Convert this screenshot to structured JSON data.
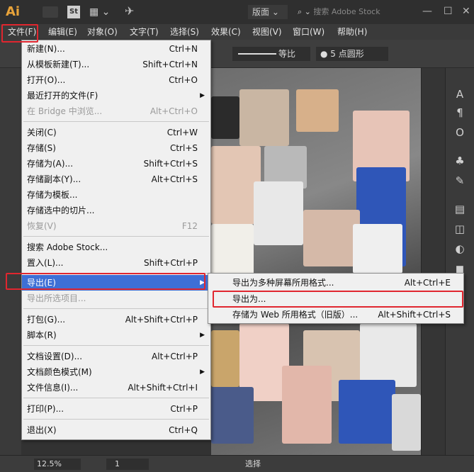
{
  "titlebar": {
    "logo": "Ai",
    "st_label": "St",
    "workspace": "版面 ⌄",
    "search_placeholder": "搜索 Adobe Stock"
  },
  "menubar": [
    {
      "id": "file",
      "label": "文件(F)"
    },
    {
      "id": "edit",
      "label": "编辑(E)"
    },
    {
      "id": "object",
      "label": "对象(O)"
    },
    {
      "id": "type",
      "label": "文字(T)"
    },
    {
      "id": "select",
      "label": "选择(S)"
    },
    {
      "id": "effect",
      "label": "效果(C)"
    },
    {
      "id": "view",
      "label": "视图(V)"
    },
    {
      "id": "window",
      "label": "窗口(W)"
    },
    {
      "id": "help",
      "label": "帮助(H)"
    }
  ],
  "controlbar": {
    "stroke_label": "等比",
    "brush_label": "●  5 点圆形"
  },
  "file_menu": [
    {
      "label": "新建(N)...",
      "shortcut": "Ctrl+N"
    },
    {
      "label": "从模板新建(T)...",
      "shortcut": "Shift+Ctrl+N"
    },
    {
      "label": "打开(O)...",
      "shortcut": "Ctrl+O"
    },
    {
      "label": "最近打开的文件(F)",
      "shortcut": "",
      "submenu": true
    },
    {
      "label": "在 Bridge 中浏览...",
      "shortcut": "Alt+Ctrl+O",
      "disabled": true
    },
    {
      "label": "关闭(C)",
      "shortcut": "Ctrl+W"
    },
    {
      "label": "存储(S)",
      "shortcut": "Ctrl+S"
    },
    {
      "label": "存储为(A)...",
      "shortcut": "Shift+Ctrl+S"
    },
    {
      "label": "存储副本(Y)...",
      "shortcut": "Alt+Ctrl+S"
    },
    {
      "label": "存储为模板...",
      "shortcut": ""
    },
    {
      "label": "存储选中的切片...",
      "shortcut": ""
    },
    {
      "label": "恢复(V)",
      "shortcut": "F12",
      "disabled": true
    },
    {
      "label": "搜索 Adobe Stock...",
      "shortcut": ""
    },
    {
      "label": "置入(L)...",
      "shortcut": "Shift+Ctrl+P"
    },
    {
      "label": "导出(E)",
      "shortcut": "",
      "submenu": true,
      "highlighted": true
    },
    {
      "label": "导出所选项目...",
      "shortcut": "",
      "disabled": true
    },
    {
      "label": "打包(G)...",
      "shortcut": "Alt+Shift+Ctrl+P"
    },
    {
      "label": "脚本(R)",
      "shortcut": "",
      "submenu": true
    },
    {
      "label": "文档设置(D)...",
      "shortcut": "Alt+Ctrl+P"
    },
    {
      "label": "文档颜色模式(M)",
      "shortcut": "",
      "submenu": true
    },
    {
      "label": "文件信息(I)...",
      "shortcut": "Alt+Shift+Ctrl+I"
    },
    {
      "label": "打印(P)...",
      "shortcut": "Ctrl+P"
    },
    {
      "label": "退出(X)",
      "shortcut": "Ctrl+Q"
    }
  ],
  "export_submenu": [
    {
      "label": "导出为多种屏幕所用格式...",
      "shortcut": "Alt+Ctrl+E"
    },
    {
      "label": "导出为...",
      "shortcut": ""
    },
    {
      "label": "存储为 Web 所用格式（旧版）...",
      "shortcut": "Alt+Shift+Ctrl+S"
    }
  ],
  "statusbar": {
    "zoom": "12.5%",
    "artboard": "1",
    "mode": "选择"
  },
  "colors": {
    "highlight": "#3d6fd6",
    "annotation": "#e0262f",
    "logo": "#e8a33a"
  }
}
